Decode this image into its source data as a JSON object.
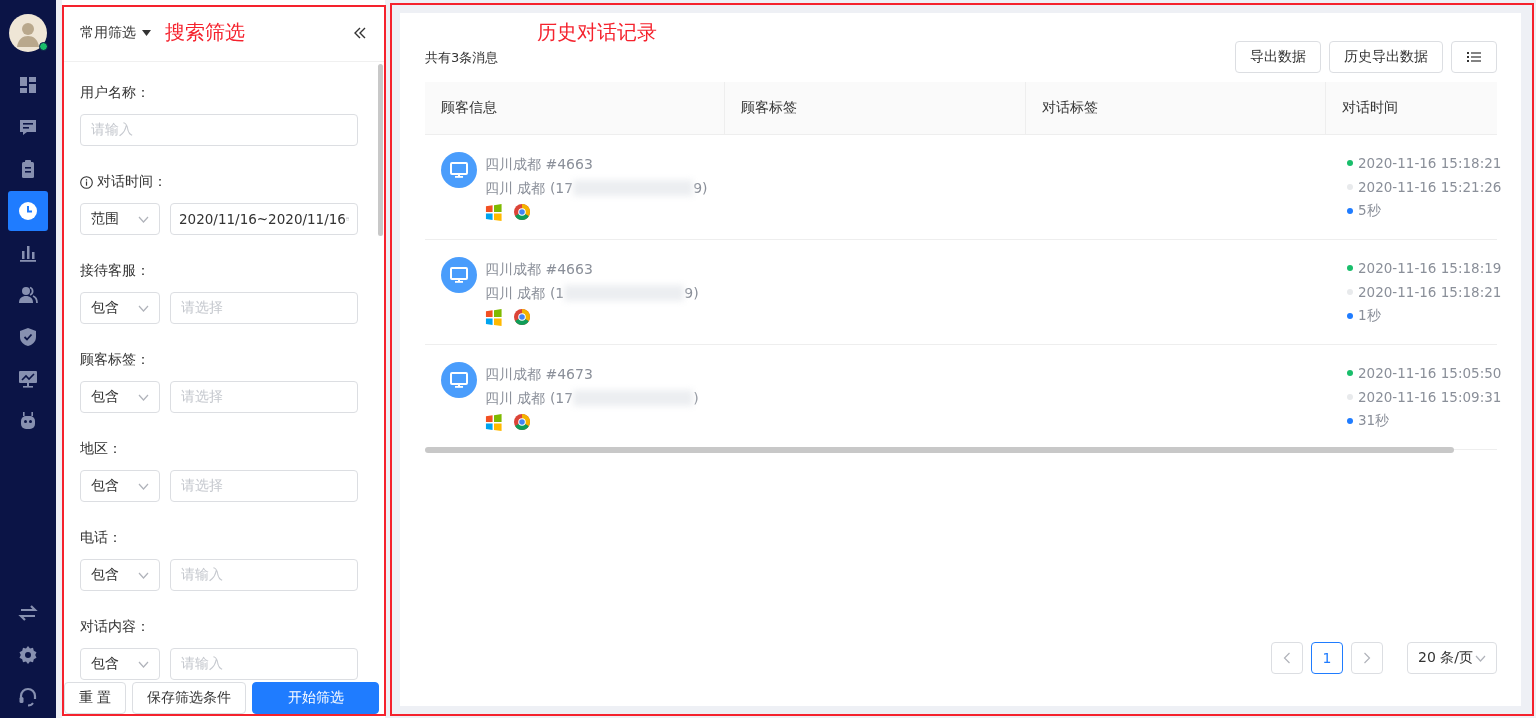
{
  "nav": {
    "avatar": {
      "online": true
    },
    "items": [
      {
        "selected": false
      },
      {
        "selected": false
      },
      {
        "selected": false
      },
      {
        "selected": true
      },
      {
        "selected": false
      },
      {
        "selected": false
      },
      {
        "selected": false
      },
      {
        "selected": false
      },
      {
        "selected": false
      }
    ],
    "bottom_items": [
      {
        "selected": false
      },
      {
        "selected": false
      },
      {
        "selected": false
      }
    ]
  },
  "filter_panel": {
    "preset": "常用筛选",
    "fields": [
      {
        "label": "用户名称：",
        "info": false,
        "kind": "input",
        "placeholder": "请输入"
      },
      {
        "label": "对话时间：",
        "info": true,
        "kind": "date",
        "operator": "范围",
        "value": "2020/11/16~2020/11/16"
      },
      {
        "label": "接待客服：",
        "info": false,
        "kind": "select",
        "operator": "包含",
        "placeholder": "请选择"
      },
      {
        "label": "顾客标签：",
        "info": false,
        "kind": "select",
        "operator": "包含",
        "placeholder": "请选择"
      },
      {
        "label": "地区：",
        "info": false,
        "kind": "select",
        "operator": "包含",
        "placeholder": "请选择"
      },
      {
        "label": "电话：",
        "info": false,
        "kind": "text",
        "operator": "包含",
        "placeholder": "请输入"
      },
      {
        "label": "对话内容：",
        "info": false,
        "kind": "text",
        "operator": "包含",
        "placeholder": "请输入"
      }
    ],
    "buttons": [
      {
        "label": "重 置",
        "kind": "default"
      },
      {
        "label": "保存筛选条件",
        "kind": "default"
      },
      {
        "label": "开始筛选",
        "kind": "primary"
      }
    ]
  },
  "history": {
    "count": "共有3条消息",
    "buttons": [
      "导出数据",
      "历史导出数据"
    ],
    "table": {
      "columns": [
        "顾客信息",
        "顾客标签",
        "对话标签",
        "对话时间"
      ],
      "rows": [
        {
          "name": "四川成都 #4663",
          "location": "四川 成都 (17",
          "location_end": "9)",
          "times": [
            {
              "text": "2020-11-16 15:18:21",
              "color": "#19be6b"
            },
            {
              "text": "2020-11-16 15:21:26",
              "color": "#e8eaec"
            },
            {
              "text": "5秒",
              "color": "#1f7cff"
            }
          ]
        },
        {
          "name": "四川成都 #4663",
          "location": "四川 成都 (1",
          "location_end": "9)",
          "times": [
            {
              "text": "2020-11-16 15:18:19",
              "color": "#19be6b"
            },
            {
              "text": "2020-11-16 15:18:21",
              "color": "#e8eaec"
            },
            {
              "text": "1秒",
              "color": "#1f7cff"
            }
          ]
        },
        {
          "name": "四川成都 #4673",
          "location": "四川 成都 (17",
          "location_end": ")",
          "times": [
            {
              "text": "2020-11-16 15:05:50",
              "color": "#19be6b"
            },
            {
              "text": "2020-11-16 15:09:31",
              "color": "#e8eaec"
            },
            {
              "text": "31秒",
              "color": "#1f7cff"
            }
          ]
        }
      ]
    },
    "pagination": {
      "pages": [
        {
          "label": "1",
          "selected": true
        }
      ],
      "page_size": "20 条/页"
    }
  },
  "annotations": {
    "filter_label": "搜索筛选",
    "history_label": "历史对话记录"
  }
}
